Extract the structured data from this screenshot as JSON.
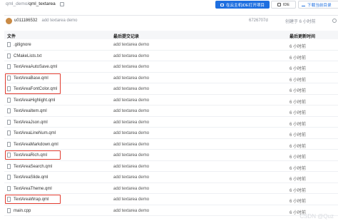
{
  "breadcrumb": {
    "repo": "qml_demo",
    "sep": "/",
    "folder": "qml_textarea"
  },
  "actions": {
    "cloud_dev": "在云主机IDE打开项目",
    "ide": "IDE",
    "download": "下载当前目录"
  },
  "last_commit": {
    "user": "u011186532",
    "message": "add textarea demo",
    "hash": "6726707d",
    "time": "创建于 6 小时前"
  },
  "table": {
    "headers": {
      "file": "文件",
      "commit": "最后提交记录",
      "time": "最后更新时间"
    },
    "rows": [
      {
        "name": ".gitignore",
        "message": "add textarea demo",
        "time": "6 小时前"
      },
      {
        "name": "CMakeLists.txt",
        "message": "add textarea demo",
        "time": "6 小时前"
      },
      {
        "name": "TextAreaAutoSave.qml",
        "message": "add textarea demo",
        "time": "6 小时前"
      },
      {
        "name": "TextAreaBase.qml",
        "message": "add textarea demo",
        "time": "6 小时前"
      },
      {
        "name": "TextAreaFontColor.qml",
        "message": "add textarea demo",
        "time": "6 小时前"
      },
      {
        "name": "TextAreaHighlight.qml",
        "message": "add textarea demo",
        "time": "6 小时前"
      },
      {
        "name": "TextAreaItem.qml",
        "message": "add textarea demo",
        "time": "6 小时前"
      },
      {
        "name": "TextAreaJson.qml",
        "message": "add textarea demo",
        "time": "6 小时前"
      },
      {
        "name": "TextAreaLineNum.qml",
        "message": "add textarea demo",
        "time": "6 小时前"
      },
      {
        "name": "TextAreaMarkdown.qml",
        "message": "add textarea demo",
        "time": "6 小时前"
      },
      {
        "name": "TextAreaRich.qml",
        "message": "add textarea demo",
        "time": "6 小时前"
      },
      {
        "name": "TextAreaSearch.qml",
        "message": "add textarea demo",
        "time": "6 小时前"
      },
      {
        "name": "TextAreaSlide.qml",
        "message": "add textarea demo",
        "time": "6 小时前"
      },
      {
        "name": "TextAreaTheme.qml",
        "message": "add textarea demo",
        "time": "6 小时前"
      },
      {
        "name": "TextAreaWrap.qml",
        "message": "add textarea demo",
        "time": "6 小时前"
      },
      {
        "name": "main.cpp",
        "message": "add textarea demo",
        "time": "6 小时前"
      }
    ]
  },
  "watermark": "CSDN @Quz",
  "highlight_color": "#e03b2f",
  "accent_color": "#1e6fe0"
}
